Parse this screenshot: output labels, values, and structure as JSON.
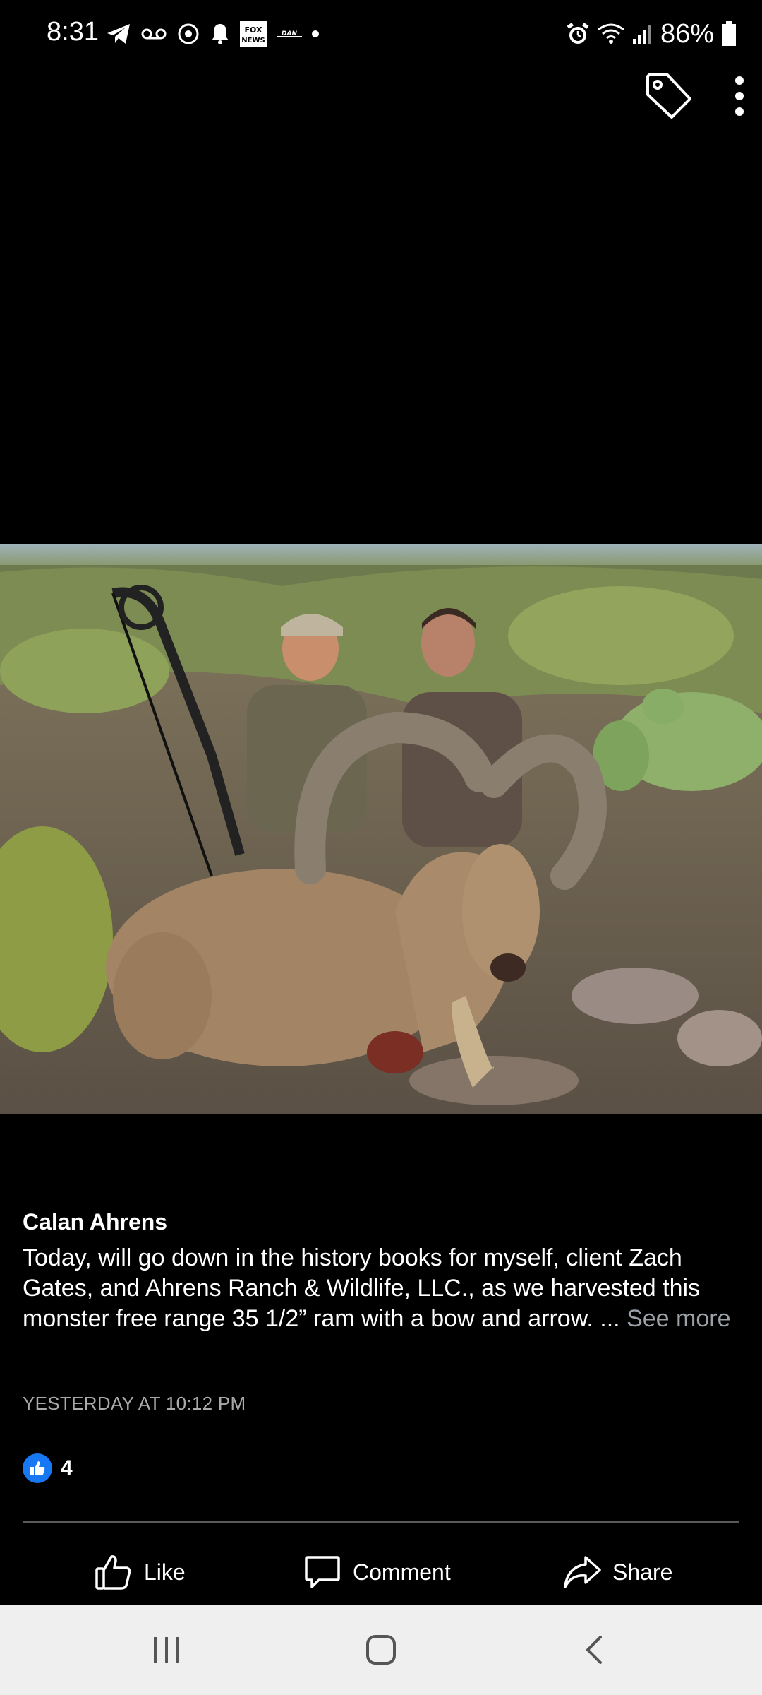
{
  "status_bar": {
    "time": "8:31",
    "battery": "86%",
    "left_icons": [
      "telegram-icon",
      "voicemail-icon",
      "sync-icon",
      "notification-bell-icon",
      "fox-news-icon",
      "dan-app-icon",
      "more-dot-icon"
    ],
    "right_icons": [
      "alarm-icon",
      "wifi-icon",
      "signal-icon",
      "battery-icon"
    ]
  },
  "top_actions": {
    "icons": [
      "tag-icon",
      "more-vertical-icon"
    ]
  },
  "photo": {
    "description_icon": "post-photo"
  },
  "post": {
    "author": "Calan Ahrens",
    "text": "Today, will go down in the history books for myself, client Zach Gates, and Ahrens Ranch & Wildlife, LLC., as we harvested this monster free range 35 1/2” ram with a bow and arrow. ...",
    "see_more": "See more",
    "timestamp": "YESTERDAY AT 10:12 PM"
  },
  "reactions": {
    "count": "4",
    "icon": "like-reaction-icon"
  },
  "actions": {
    "like": "Like",
    "comment": "Comment",
    "share": "Share"
  },
  "nav": {
    "icons": [
      "recents-icon",
      "home-icon",
      "back-icon"
    ]
  },
  "colors": {
    "background": "#000000",
    "like_blue": "#1877f2",
    "muted_text": "#9aa0a6",
    "nav_bg": "#efefef"
  }
}
